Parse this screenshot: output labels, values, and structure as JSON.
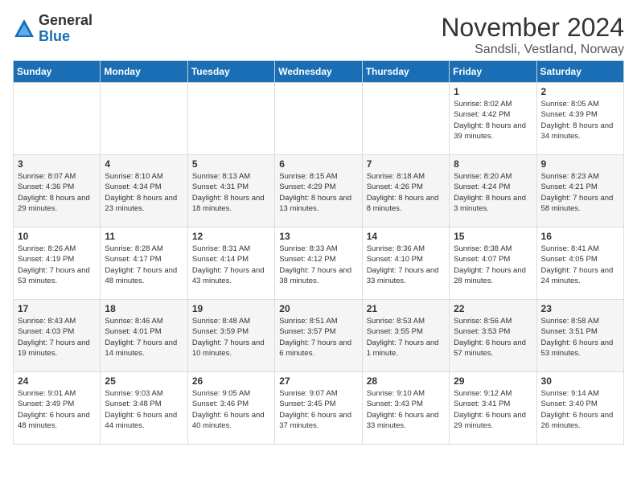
{
  "logo": {
    "general": "General",
    "blue": "Blue"
  },
  "title": "November 2024",
  "location": "Sandsli, Vestland, Norway",
  "days_of_week": [
    "Sunday",
    "Monday",
    "Tuesday",
    "Wednesday",
    "Thursday",
    "Friday",
    "Saturday"
  ],
  "weeks": [
    [
      {
        "day": "",
        "info": ""
      },
      {
        "day": "",
        "info": ""
      },
      {
        "day": "",
        "info": ""
      },
      {
        "day": "",
        "info": ""
      },
      {
        "day": "",
        "info": ""
      },
      {
        "day": "1",
        "info": "Sunrise: 8:02 AM\nSunset: 4:42 PM\nDaylight: 8 hours and 39 minutes."
      },
      {
        "day": "2",
        "info": "Sunrise: 8:05 AM\nSunset: 4:39 PM\nDaylight: 8 hours and 34 minutes."
      }
    ],
    [
      {
        "day": "3",
        "info": "Sunrise: 8:07 AM\nSunset: 4:36 PM\nDaylight: 8 hours and 29 minutes."
      },
      {
        "day": "4",
        "info": "Sunrise: 8:10 AM\nSunset: 4:34 PM\nDaylight: 8 hours and 23 minutes."
      },
      {
        "day": "5",
        "info": "Sunrise: 8:13 AM\nSunset: 4:31 PM\nDaylight: 8 hours and 18 minutes."
      },
      {
        "day": "6",
        "info": "Sunrise: 8:15 AM\nSunset: 4:29 PM\nDaylight: 8 hours and 13 minutes."
      },
      {
        "day": "7",
        "info": "Sunrise: 8:18 AM\nSunset: 4:26 PM\nDaylight: 8 hours and 8 minutes."
      },
      {
        "day": "8",
        "info": "Sunrise: 8:20 AM\nSunset: 4:24 PM\nDaylight: 8 hours and 3 minutes."
      },
      {
        "day": "9",
        "info": "Sunrise: 8:23 AM\nSunset: 4:21 PM\nDaylight: 7 hours and 58 minutes."
      }
    ],
    [
      {
        "day": "10",
        "info": "Sunrise: 8:26 AM\nSunset: 4:19 PM\nDaylight: 7 hours and 53 minutes."
      },
      {
        "day": "11",
        "info": "Sunrise: 8:28 AM\nSunset: 4:17 PM\nDaylight: 7 hours and 48 minutes."
      },
      {
        "day": "12",
        "info": "Sunrise: 8:31 AM\nSunset: 4:14 PM\nDaylight: 7 hours and 43 minutes."
      },
      {
        "day": "13",
        "info": "Sunrise: 8:33 AM\nSunset: 4:12 PM\nDaylight: 7 hours and 38 minutes."
      },
      {
        "day": "14",
        "info": "Sunrise: 8:36 AM\nSunset: 4:10 PM\nDaylight: 7 hours and 33 minutes."
      },
      {
        "day": "15",
        "info": "Sunrise: 8:38 AM\nSunset: 4:07 PM\nDaylight: 7 hours and 28 minutes."
      },
      {
        "day": "16",
        "info": "Sunrise: 8:41 AM\nSunset: 4:05 PM\nDaylight: 7 hours and 24 minutes."
      }
    ],
    [
      {
        "day": "17",
        "info": "Sunrise: 8:43 AM\nSunset: 4:03 PM\nDaylight: 7 hours and 19 minutes."
      },
      {
        "day": "18",
        "info": "Sunrise: 8:46 AM\nSunset: 4:01 PM\nDaylight: 7 hours and 14 minutes."
      },
      {
        "day": "19",
        "info": "Sunrise: 8:48 AM\nSunset: 3:59 PM\nDaylight: 7 hours and 10 minutes."
      },
      {
        "day": "20",
        "info": "Sunrise: 8:51 AM\nSunset: 3:57 PM\nDaylight: 7 hours and 6 minutes."
      },
      {
        "day": "21",
        "info": "Sunrise: 8:53 AM\nSunset: 3:55 PM\nDaylight: 7 hours and 1 minute."
      },
      {
        "day": "22",
        "info": "Sunrise: 8:56 AM\nSunset: 3:53 PM\nDaylight: 6 hours and 57 minutes."
      },
      {
        "day": "23",
        "info": "Sunrise: 8:58 AM\nSunset: 3:51 PM\nDaylight: 6 hours and 53 minutes."
      }
    ],
    [
      {
        "day": "24",
        "info": "Sunrise: 9:01 AM\nSunset: 3:49 PM\nDaylight: 6 hours and 48 minutes."
      },
      {
        "day": "25",
        "info": "Sunrise: 9:03 AM\nSunset: 3:48 PM\nDaylight: 6 hours and 44 minutes."
      },
      {
        "day": "26",
        "info": "Sunrise: 9:05 AM\nSunset: 3:46 PM\nDaylight: 6 hours and 40 minutes."
      },
      {
        "day": "27",
        "info": "Sunrise: 9:07 AM\nSunset: 3:45 PM\nDaylight: 6 hours and 37 minutes."
      },
      {
        "day": "28",
        "info": "Sunrise: 9:10 AM\nSunset: 3:43 PM\nDaylight: 6 hours and 33 minutes."
      },
      {
        "day": "29",
        "info": "Sunrise: 9:12 AM\nSunset: 3:41 PM\nDaylight: 6 hours and 29 minutes."
      },
      {
        "day": "30",
        "info": "Sunrise: 9:14 AM\nSunset: 3:40 PM\nDaylight: 6 hours and 26 minutes."
      }
    ]
  ]
}
